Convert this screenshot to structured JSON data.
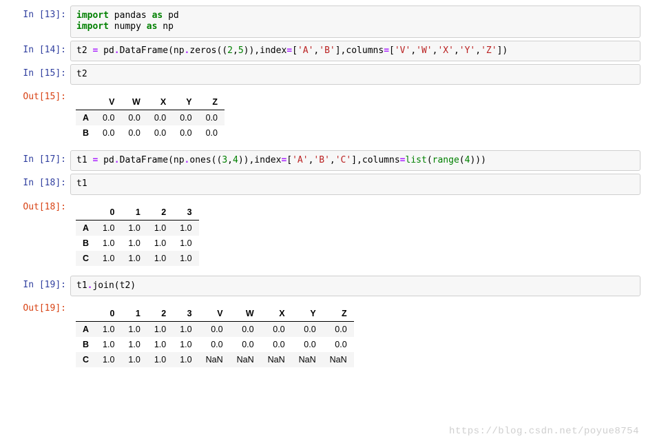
{
  "cells": [
    {
      "in_prompt": "In [13]:",
      "code_tokens": [
        {
          "t": "import",
          "c": "kw"
        },
        {
          "t": " pandas ",
          "c": "id"
        },
        {
          "t": "as",
          "c": "kw"
        },
        {
          "t": " pd\n",
          "c": "id"
        },
        {
          "t": "import",
          "c": "kw"
        },
        {
          "t": " numpy ",
          "c": "id"
        },
        {
          "t": "as",
          "c": "kw"
        },
        {
          "t": " np",
          "c": "id"
        }
      ]
    },
    {
      "in_prompt": "In [14]:",
      "code_tokens": [
        {
          "t": "t2 ",
          "c": "id"
        },
        {
          "t": "=",
          "c": "op"
        },
        {
          "t": " pd",
          "c": "id"
        },
        {
          "t": ".",
          "c": "op"
        },
        {
          "t": "DataFrame(np",
          "c": "id"
        },
        {
          "t": ".",
          "c": "op"
        },
        {
          "t": "zeros((",
          "c": "id"
        },
        {
          "t": "2",
          "c": "num"
        },
        {
          "t": ",",
          "c": "id"
        },
        {
          "t": "5",
          "c": "num"
        },
        {
          "t": ")),index",
          "c": "id"
        },
        {
          "t": "=",
          "c": "op"
        },
        {
          "t": "[",
          "c": "id"
        },
        {
          "t": "'A'",
          "c": "str"
        },
        {
          "t": ",",
          "c": "id"
        },
        {
          "t": "'B'",
          "c": "str"
        },
        {
          "t": "],columns",
          "c": "id"
        },
        {
          "t": "=",
          "c": "op"
        },
        {
          "t": "[",
          "c": "id"
        },
        {
          "t": "'V'",
          "c": "str"
        },
        {
          "t": ",",
          "c": "id"
        },
        {
          "t": "'W'",
          "c": "str"
        },
        {
          "t": ",",
          "c": "id"
        },
        {
          "t": "'X'",
          "c": "str"
        },
        {
          "t": ",",
          "c": "id"
        },
        {
          "t": "'Y'",
          "c": "str"
        },
        {
          "t": ",",
          "c": "id"
        },
        {
          "t": "'Z'",
          "c": "str"
        },
        {
          "t": "])",
          "c": "id"
        }
      ]
    },
    {
      "in_prompt": "In [15]:",
      "code_tokens": [
        {
          "t": "t2",
          "c": "id"
        }
      ],
      "out_prompt": "Out[15]:",
      "table": {
        "columns": [
          "V",
          "W",
          "X",
          "Y",
          "Z"
        ],
        "index": [
          "A",
          "B"
        ],
        "rows": [
          [
            "0.0",
            "0.0",
            "0.0",
            "0.0",
            "0.0"
          ],
          [
            "0.0",
            "0.0",
            "0.0",
            "0.0",
            "0.0"
          ]
        ]
      }
    },
    {
      "in_prompt": "In [17]:",
      "code_tokens": [
        {
          "t": "t1 ",
          "c": "id"
        },
        {
          "t": "=",
          "c": "op"
        },
        {
          "t": " pd",
          "c": "id"
        },
        {
          "t": ".",
          "c": "op"
        },
        {
          "t": "DataFrame(np",
          "c": "id"
        },
        {
          "t": ".",
          "c": "op"
        },
        {
          "t": "ones((",
          "c": "id"
        },
        {
          "t": "3",
          "c": "num"
        },
        {
          "t": ",",
          "c": "id"
        },
        {
          "t": "4",
          "c": "num"
        },
        {
          "t": ")),index",
          "c": "id"
        },
        {
          "t": "=",
          "c": "op"
        },
        {
          "t": "[",
          "c": "id"
        },
        {
          "t": "'A'",
          "c": "str"
        },
        {
          "t": ",",
          "c": "id"
        },
        {
          "t": "'B'",
          "c": "str"
        },
        {
          "t": ",",
          "c": "id"
        },
        {
          "t": "'C'",
          "c": "str"
        },
        {
          "t": "],columns",
          "c": "id"
        },
        {
          "t": "=",
          "c": "op"
        },
        {
          "t": "list",
          "c": "fn"
        },
        {
          "t": "(",
          "c": "id"
        },
        {
          "t": "range",
          "c": "fn"
        },
        {
          "t": "(",
          "c": "id"
        },
        {
          "t": "4",
          "c": "num"
        },
        {
          "t": ")))",
          "c": "id"
        }
      ]
    },
    {
      "in_prompt": "In [18]:",
      "code_tokens": [
        {
          "t": "t1",
          "c": "id"
        }
      ],
      "out_prompt": "Out[18]:",
      "table": {
        "columns": [
          "0",
          "1",
          "2",
          "3"
        ],
        "index": [
          "A",
          "B",
          "C"
        ],
        "rows": [
          [
            "1.0",
            "1.0",
            "1.0",
            "1.0"
          ],
          [
            "1.0",
            "1.0",
            "1.0",
            "1.0"
          ],
          [
            "1.0",
            "1.0",
            "1.0",
            "1.0"
          ]
        ]
      }
    },
    {
      "in_prompt": "In [19]:",
      "code_tokens": [
        {
          "t": "t1",
          "c": "id"
        },
        {
          "t": ".",
          "c": "op"
        },
        {
          "t": "join(t2)",
          "c": "id"
        }
      ],
      "out_prompt": "Out[19]:",
      "table": {
        "columns": [
          "0",
          "1",
          "2",
          "3",
          "V",
          "W",
          "X",
          "Y",
          "Z"
        ],
        "index": [
          "A",
          "B",
          "C"
        ],
        "rows": [
          [
            "1.0",
            "1.0",
            "1.0",
            "1.0",
            "0.0",
            "0.0",
            "0.0",
            "0.0",
            "0.0"
          ],
          [
            "1.0",
            "1.0",
            "1.0",
            "1.0",
            "0.0",
            "0.0",
            "0.0",
            "0.0",
            "0.0"
          ],
          [
            "1.0",
            "1.0",
            "1.0",
            "1.0",
            "NaN",
            "NaN",
            "NaN",
            "NaN",
            "NaN"
          ]
        ]
      }
    }
  ],
  "watermark": "https://blog.csdn.net/poyue8754"
}
